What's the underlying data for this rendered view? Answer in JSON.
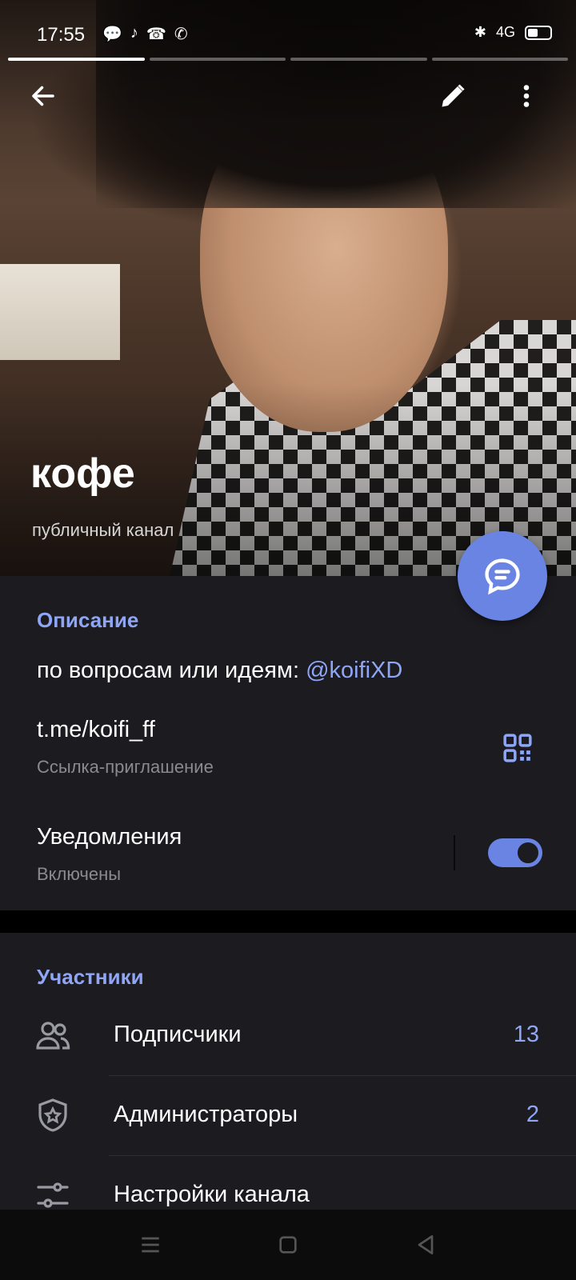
{
  "status_bar": {
    "time": "17:55",
    "network": "4G"
  },
  "header": {
    "channel_name": "кофе",
    "channel_type": "публичный канал"
  },
  "info": {
    "description_title": "Описание",
    "description_text": "по вопросам или идеям: ",
    "description_mention": "@koifiXD",
    "link": "t.me/koifi_ff",
    "link_caption": "Ссылка-приглашение",
    "notifications_label": "Уведомления",
    "notifications_state": "Включены",
    "notifications_on": true
  },
  "members": {
    "section_title": "Участники",
    "rows": [
      {
        "label": "Подписчики",
        "count": "13",
        "icon": "people-icon"
      },
      {
        "label": "Администраторы",
        "count": "2",
        "icon": "shield-star-icon"
      },
      {
        "label": "Настройки канала",
        "count": "",
        "icon": "sliders-icon"
      }
    ]
  },
  "colors": {
    "accent": "#6a84e4",
    "link": "#8fa5f5",
    "panel": "#1c1b20"
  }
}
